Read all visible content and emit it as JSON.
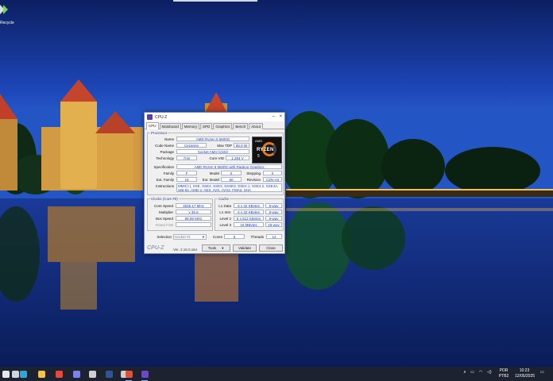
{
  "desktop": {
    "icon_label": "Recycle",
    "icon_name": "recycle-bin-icon"
  },
  "window": {
    "title": "CPU-Z",
    "tabs": [
      "CPU",
      "Mainboard",
      "Memory",
      "SPD",
      "Graphics",
      "Bench",
      "About"
    ],
    "active_tab": 0,
    "processor": {
      "group_label": "Processor",
      "name_label": "Name",
      "name": "AMD Ryzen 5 5600G",
      "codename_label": "Code Name",
      "codename": "Cezanne",
      "maxtdp_label": "Max TDP",
      "maxtdp": "65.0 W",
      "package_label": "Package",
      "package": "Socket AM4 (1331)",
      "technology_label": "Technology",
      "technology": "7nm",
      "corevid_label": "Core VID",
      "corevid": "1.284 V",
      "spec_label": "Specification",
      "spec": "AMD Ryzen 5 5600G with Radeon Graphics",
      "family_label": "Family",
      "family": "F",
      "model_label": "Model",
      "model": "0",
      "stepping_label": "Stepping",
      "stepping": "0",
      "extfamily_label": "Ext. Family",
      "extfamily": "19",
      "extmodel_label": "Ext. Model",
      "extmodel": "50",
      "revision_label": "Revision",
      "revision": "CZN-A0",
      "instructions_label": "Instructions",
      "instructions": "MMX(+), SSE, SSE2, SSE3, SSSE3, SSE4.1, SSE4.2, SSE4A, x86-64, AMD-V, AES, AVX, AVX2, FMA3, SHA",
      "logo": {
        "brand": "AMD",
        "word": "RYZEN",
        "num": "5"
      }
    },
    "clocks": {
      "group_label": "Clocks (Core #0)",
      "corespeed_label": "Core Speed",
      "corespeed": "3545.17 MHz",
      "multiplier_label": "Multiplier",
      "multiplier": "x 35.6",
      "busspeed_label": "Bus Speed",
      "busspeed": "99.59 MHz",
      "ratedfsb_label": "Rated FSB",
      "ratedfsb": ""
    },
    "cache": {
      "group_label": "Cache",
      "rows": [
        {
          "label": "L1 Data",
          "size": "6 x 32 KBytes",
          "way": "8-way"
        },
        {
          "label": "L1 Inst.",
          "size": "6 x 32 KBytes",
          "way": "8-way"
        },
        {
          "label": "Level 2",
          "size": "6 x 512 KBytes",
          "way": "8-way"
        },
        {
          "label": "Level 3",
          "size": "16 MBytes",
          "way": "16-way"
        }
      ]
    },
    "selection_label": "Selection",
    "selection_value": "Socket #1",
    "cores_label": "Cores",
    "cores": "6",
    "threads_label": "Threads",
    "threads": "12",
    "footer_logo": "CPU-Z",
    "version": "Ver. 2.15.0.x64",
    "tools_label": "Tools",
    "validate_label": "Validate",
    "close_label": "Close"
  },
  "taskbar": {
    "apps": [
      {
        "name": "start-icon",
        "color": "#e8e8e8"
      },
      {
        "name": "search-icon",
        "color": "#cfd6e2"
      },
      {
        "name": "edge-icon",
        "color": "#2fa6d8"
      },
      {
        "name": "explorer-icon",
        "color": "#f2c14e"
      },
      {
        "name": "chrome-icon",
        "color": "#e24a3b"
      },
      {
        "name": "teams-icon",
        "color": "#7b83eb"
      },
      {
        "name": "files-icon",
        "color": "#d0d0d0"
      },
      {
        "name": "word-icon",
        "color": "#2b579a"
      },
      {
        "name": "app-icon",
        "color": "#cfcfcf"
      },
      {
        "name": "pdf-icon",
        "color": "#d9533b"
      },
      {
        "name": "cpuz-icon",
        "color": "#6c4bc0"
      }
    ],
    "lang_top": "POR",
    "lang_bottom": "PTB2",
    "time": "10:23",
    "date": "12/05/2025"
  }
}
